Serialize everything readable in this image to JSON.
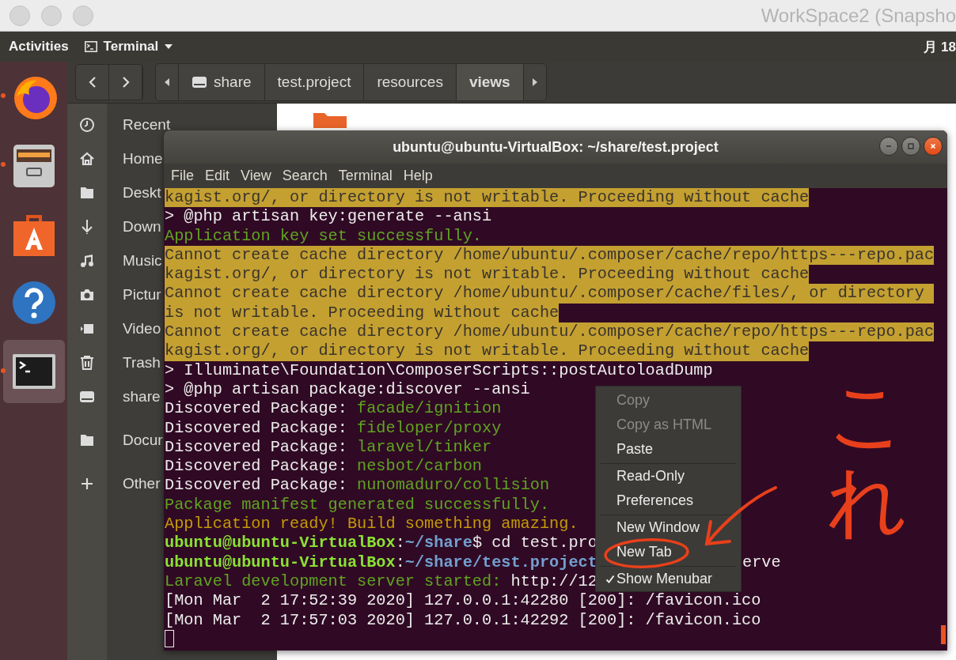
{
  "mac_window": {
    "title": "WorkSpace2 (Snapsho"
  },
  "top_bar": {
    "activities": "Activities",
    "app_menu": "Terminal",
    "clock": "月 18"
  },
  "dock": {
    "items": [
      {
        "kind": "firefox",
        "running": true,
        "selected": false
      },
      {
        "kind": "files",
        "running": true,
        "selected": false
      },
      {
        "kind": "software",
        "running": false,
        "selected": false
      },
      {
        "kind": "help",
        "running": false,
        "selected": false
      },
      {
        "kind": "terminal",
        "running": true,
        "selected": true
      }
    ]
  },
  "files": {
    "path": [
      {
        "label": "share",
        "kind": "drive",
        "selected": false
      },
      {
        "label": "test.project",
        "kind": "folder",
        "selected": false
      },
      {
        "label": "resources",
        "kind": "folder",
        "selected": false
      },
      {
        "label": "views",
        "kind": "folder",
        "selected": true
      }
    ],
    "sidebar": [
      {
        "label": "Recent",
        "kind": "clock",
        "separator_before": false
      },
      {
        "label": "Home",
        "kind": "home",
        "separator_before": false
      },
      {
        "label": "Deskt",
        "kind": "folder",
        "separator_before": false
      },
      {
        "label": "Down",
        "kind": "download",
        "separator_before": false
      },
      {
        "label": "Music",
        "kind": "music",
        "separator_before": false
      },
      {
        "label": "Pictur",
        "kind": "camera",
        "separator_before": false
      },
      {
        "label": "Video",
        "kind": "video",
        "separator_before": false
      },
      {
        "label": "Trash",
        "kind": "trash",
        "separator_before": false
      },
      {
        "label": "share",
        "kind": "drive",
        "separator_before": false
      },
      {
        "label": "Docur",
        "kind": "folder",
        "separator_before": true
      },
      {
        "label": "Other",
        "kind": "plus",
        "separator_before": true
      }
    ]
  },
  "terminal": {
    "title": "ubuntu@ubuntu-VirtualBox: ~/share/test.project",
    "menu": [
      "File",
      "Edit",
      "View",
      "Search",
      "Terminal",
      "Help"
    ],
    "lines": [
      [
        {
          "text": "kagist.org/, or directory is not writable. Proceeding without cache",
          "kind": "warn"
        }
      ],
      [
        {
          "text": "> @php artisan key:generate --ansi",
          "kind": "plain"
        }
      ],
      [
        {
          "text": "Application key set successfully.",
          "kind": "green"
        }
      ],
      [
        {
          "text": "Cannot create cache directory /home/ubuntu/.composer/cache/repo/https---repo.pac",
          "kind": "warn"
        }
      ],
      [
        {
          "text": "kagist.org/, or directory is not writable. Proceeding without cache",
          "kind": "warn"
        }
      ],
      [
        {
          "text": "Cannot create cache directory /home/ubuntu/.composer/cache/files/, or directory ",
          "kind": "warn"
        }
      ],
      [
        {
          "text": "is not writable. Proceeding without cache",
          "kind": "warn"
        }
      ],
      [
        {
          "text": "Cannot create cache directory /home/ubuntu/.composer/cache/repo/https---repo.pac",
          "kind": "warn"
        }
      ],
      [
        {
          "text": "kagist.org/, or directory is not writable. Proceeding without cache",
          "kind": "warn"
        }
      ],
      [
        {
          "text": "> Illuminate\\Foundation\\ComposerScripts::postAutoloadDump",
          "kind": "plain"
        }
      ],
      [
        {
          "text": "> @php artisan package:discover --ansi",
          "kind": "plain"
        }
      ],
      [
        {
          "text": "Discovered Package: ",
          "kind": "plain"
        },
        {
          "text": "facade/ignition",
          "kind": "green"
        }
      ],
      [
        {
          "text": "Discovered Package: ",
          "kind": "plain"
        },
        {
          "text": "fideloper/proxy",
          "kind": "green"
        }
      ],
      [
        {
          "text": "Discovered Package: ",
          "kind": "plain"
        },
        {
          "text": "laravel/tinker",
          "kind": "green"
        }
      ],
      [
        {
          "text": "Discovered Package: ",
          "kind": "plain"
        },
        {
          "text": "nesbot/carbon",
          "kind": "green"
        }
      ],
      [
        {
          "text": "Discovered Package: ",
          "kind": "plain"
        },
        {
          "text": "nunomaduro/collision",
          "kind": "green"
        }
      ],
      [
        {
          "text": "Package manifest generated successfully.",
          "kind": "green"
        }
      ],
      [
        {
          "text": "Application ready! Build something amazing.",
          "kind": "amber"
        }
      ],
      [
        {
          "text": "ubuntu@ubuntu-VirtualBox",
          "kind": "user"
        },
        {
          "text": ":",
          "kind": "plain"
        },
        {
          "text": "~/share",
          "kind": "path"
        },
        {
          "text": "$ cd test.pro",
          "kind": "plain"
        }
      ],
      [
        {
          "text": "ubuntu@ubuntu-VirtualBox",
          "kind": "user"
        },
        {
          "text": ":",
          "kind": "plain"
        },
        {
          "text": "~/share/test.project",
          "kind": "path"
        },
        {
          "text": "erve",
          "kind": "plain",
          "after_menu": true
        }
      ],
      [
        {
          "text": "Laravel development server started: ",
          "kind": "green"
        },
        {
          "text": "http://12",
          "kind": "plain"
        }
      ],
      [
        {
          "text": "[Mon Mar  2 17:52:39 2020] 127.0.0.1:42280 [200]: /favicon.ico",
          "kind": "plain"
        }
      ],
      [
        {
          "text": "[Mon Mar  2 17:57:03 2020] 127.0.0.1:42292 [200]: /favicon.ico",
          "kind": "plain"
        }
      ]
    ],
    "cursor": true,
    "context_menu": {
      "groups": [
        [
          {
            "label": "Copy",
            "disabled": true
          },
          {
            "label": "Copy as HTML",
            "disabled": true
          },
          {
            "label": "Paste",
            "disabled": false
          }
        ],
        [
          {
            "label": "Read-Only",
            "disabled": false,
            "checked": false
          },
          {
            "label": "Preferences",
            "disabled": false
          }
        ],
        [
          {
            "label": "New Window",
            "disabled": false
          },
          {
            "label": "New Tab",
            "disabled": false
          }
        ],
        [
          {
            "label": "Show Menubar",
            "disabled": false,
            "checked": true
          }
        ]
      ]
    }
  },
  "annotation": {
    "text": "これ"
  }
}
